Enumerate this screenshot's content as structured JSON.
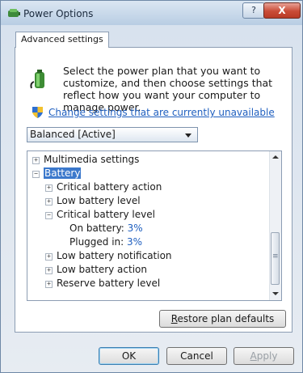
{
  "window": {
    "title": "Power Options",
    "help_label": "?",
    "close_label": "X"
  },
  "tab": {
    "label": "Advanced settings"
  },
  "description": "Select the power plan that you want to customize, and then choose settings that reflect how you want your computer to manage power.",
  "change_link": "Change settings that are currently unavailable",
  "plan_select": {
    "value": "Balanced [Active]"
  },
  "tree": {
    "multimedia": {
      "expander": "+",
      "label": "Multimedia settings"
    },
    "battery": {
      "expander": "−",
      "label": "Battery"
    },
    "critical_action": {
      "expander": "+",
      "label": "Critical battery action"
    },
    "low_level": {
      "expander": "+",
      "label": "Low battery level"
    },
    "critical_level": {
      "expander": "−",
      "label": "Critical battery level"
    },
    "on_battery": {
      "label": "On battery:",
      "value": "3%"
    },
    "plugged_in": {
      "label": "Plugged in:",
      "value": "3%"
    },
    "low_notification": {
      "expander": "+",
      "label": "Low battery notification"
    },
    "low_action": {
      "expander": "+",
      "label": "Low battery action"
    },
    "reserve_level": {
      "expander": "+",
      "label": "Reserve battery level"
    }
  },
  "buttons": {
    "restore": {
      "accesskey": "R",
      "rest": "estore plan defaults"
    },
    "ok": "OK",
    "cancel": "Cancel",
    "apply": {
      "accesskey": "A",
      "rest": "pply"
    }
  },
  "colors": {
    "link": "#1f5fbf",
    "selection": "#3c79cc"
  }
}
